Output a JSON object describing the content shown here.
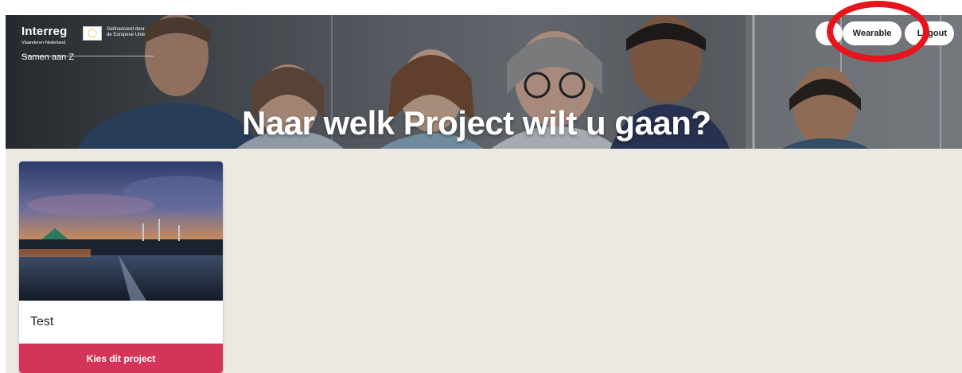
{
  "header": {
    "logo": {
      "name": "Interreg",
      "region": "Vlaanderen-Nederland",
      "eu_text_line1": "Gefinancierd door",
      "eu_text_line2": "de Europese Unie"
    },
    "site_name": "Samen aan Z",
    "title": "Naar welk Project wilt u gaan?",
    "nav": {
      "left_button": "",
      "wearable": "Wearable",
      "logout": "Logout"
    }
  },
  "projects": [
    {
      "name": "Test",
      "button_label": "Kies dit project"
    }
  ],
  "colors": {
    "accent": "#d43458",
    "page_background": "#ece8e2",
    "annotation": "#e8141c"
  }
}
